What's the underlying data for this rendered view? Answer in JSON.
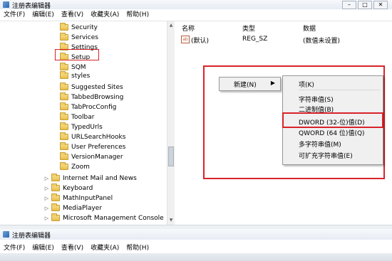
{
  "window": {
    "title": "注册表编辑器",
    "buttons": [
      "–",
      "□",
      "✕"
    ]
  },
  "menu": [
    "文件(F)",
    "编辑(E)",
    "查看(V)",
    "收藏夹(A)",
    "帮助(H)"
  ],
  "tree": {
    "items": [
      {
        "label": "Security"
      },
      {
        "label": "Services"
      },
      {
        "label": "Settings"
      },
      {
        "label": "Setup"
      },
      {
        "label": "SQM"
      },
      {
        "label": "styles"
      },
      {
        "label": "Suggested Sites"
      },
      {
        "label": "TabbedBrowsing"
      },
      {
        "label": "TabProcConfig"
      },
      {
        "label": "Toolbar"
      },
      {
        "label": "TypedUrls"
      },
      {
        "label": "URLSearchHooks"
      },
      {
        "label": "User Preferences"
      },
      {
        "label": "VersionManager"
      },
      {
        "label": "Zoom"
      }
    ],
    "root_items": [
      {
        "label": "Internet Mail and News"
      },
      {
        "label": "Keyboard"
      },
      {
        "label": "MathInputPanel"
      },
      {
        "label": "MediaPlayer"
      },
      {
        "label": "Microsoft Management Console"
      }
    ]
  },
  "values": {
    "headers": {
      "name": "名称",
      "type": "类型",
      "data": "数据"
    },
    "row": {
      "name": "(默认)",
      "type": "REG_SZ",
      "data": "(数值未设置)"
    }
  },
  "context_menu": {
    "new_label": "新建(N)",
    "arrow": "▶"
  },
  "submenu": {
    "items": [
      "项(K)",
      "字符串值(S)",
      "二进制值(B)",
      "DWORD (32-位)值(D)",
      "QWORD (64 位)值(Q)",
      "多字符串值(M)",
      "可扩充字符串值(E)"
    ]
  },
  "second_window": {
    "title": "注册表编辑器",
    "menu": [
      "文件(F)",
      "编辑(E)",
      "查看(V)",
      "收藏夹(A)",
      "帮助(H)"
    ]
  },
  "colors": {
    "highlight": "#d8232a",
    "folder": "#e8be4b"
  }
}
